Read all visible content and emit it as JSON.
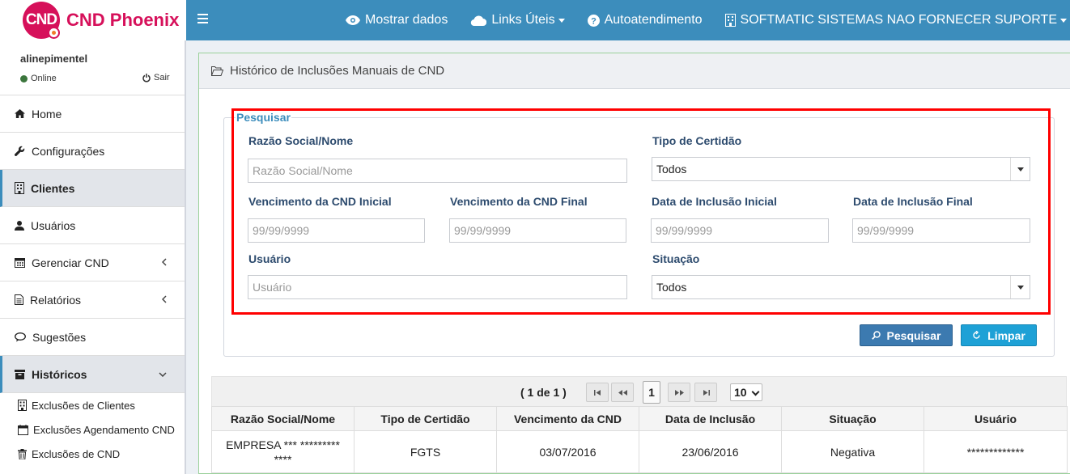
{
  "app": {
    "logo_badge": "CND",
    "logo_text": "CND Phoenix",
    "brand_color": "#d6105a",
    "header_color": "#3c8dbc"
  },
  "topbar": {
    "items": [
      {
        "label": "Mostrar dados",
        "icon": "eye-icon"
      },
      {
        "label": "Links Úteis",
        "icon": "cloud-icon",
        "dropdown": true
      },
      {
        "label": "Autoatendimento",
        "icon": "question-circle-icon"
      },
      {
        "label": "SOFTMATIC SISTEMAS NAO FORNECER SUPORTE",
        "icon": "building-icon",
        "dropdown": true
      }
    ]
  },
  "user": {
    "name": "alinepimentel",
    "status": "Online",
    "logout": "Sair"
  },
  "sidebar": {
    "items": [
      {
        "label": "Home",
        "icon": "home-icon"
      },
      {
        "label": "Configurações",
        "icon": "wrench-icon"
      },
      {
        "label": "Clientes",
        "icon": "building-icon"
      },
      {
        "label": "Usuários",
        "icon": "user-icon"
      },
      {
        "label": "Gerenciar CND",
        "icon": "calendar-icon"
      },
      {
        "label": "Relatórios",
        "icon": "file-icon"
      },
      {
        "label": "Sugestões",
        "icon": "comments-icon"
      },
      {
        "label": "Históricos",
        "icon": "archive-icon"
      }
    ],
    "subitems": [
      {
        "label": "Exclusões de Clientes",
        "icon": "building-icon"
      },
      {
        "label": "Exclusões Agendamento CND",
        "icon": "calendar-icon"
      },
      {
        "label": "Exclusões de CND",
        "icon": "trash-icon"
      }
    ]
  },
  "page": {
    "title": "Histórico de Inclusões Manuais de CND"
  },
  "search": {
    "legend": "Pesquisar",
    "razao_label": "Razão Social/Nome",
    "razao_placeholder": "Razão Social/Nome",
    "tipo_label": "Tipo de Certidão",
    "tipo_value": "Todos",
    "venc_ini_label": "Vencimento da CND Inicial",
    "venc_fim_label": "Vencimento da CND Final",
    "incl_ini_label": "Data de Inclusão Inicial",
    "incl_fim_label": "Data de Inclusão Final",
    "date_placeholder": "99/99/9999",
    "usuario_label": "Usuário",
    "usuario_placeholder": "Usuário",
    "situacao_label": "Situação",
    "situacao_value": "Todos",
    "search_btn": "Pesquisar",
    "clear_btn": "Limpar"
  },
  "pager": {
    "text": "( 1 de 1 )",
    "current_page": "1",
    "rows_per_page": "10"
  },
  "table": {
    "headers": [
      "Razão Social/Nome",
      "Tipo de Certidão",
      "Vencimento da CND",
      "Data de Inclusão",
      "Situação",
      "Usuário"
    ],
    "rows": [
      [
        "EMPRESA *** ********* ****",
        "FGTS",
        "03/07/2016",
        "23/06/2016",
        "Negativa",
        "*************"
      ]
    ]
  }
}
